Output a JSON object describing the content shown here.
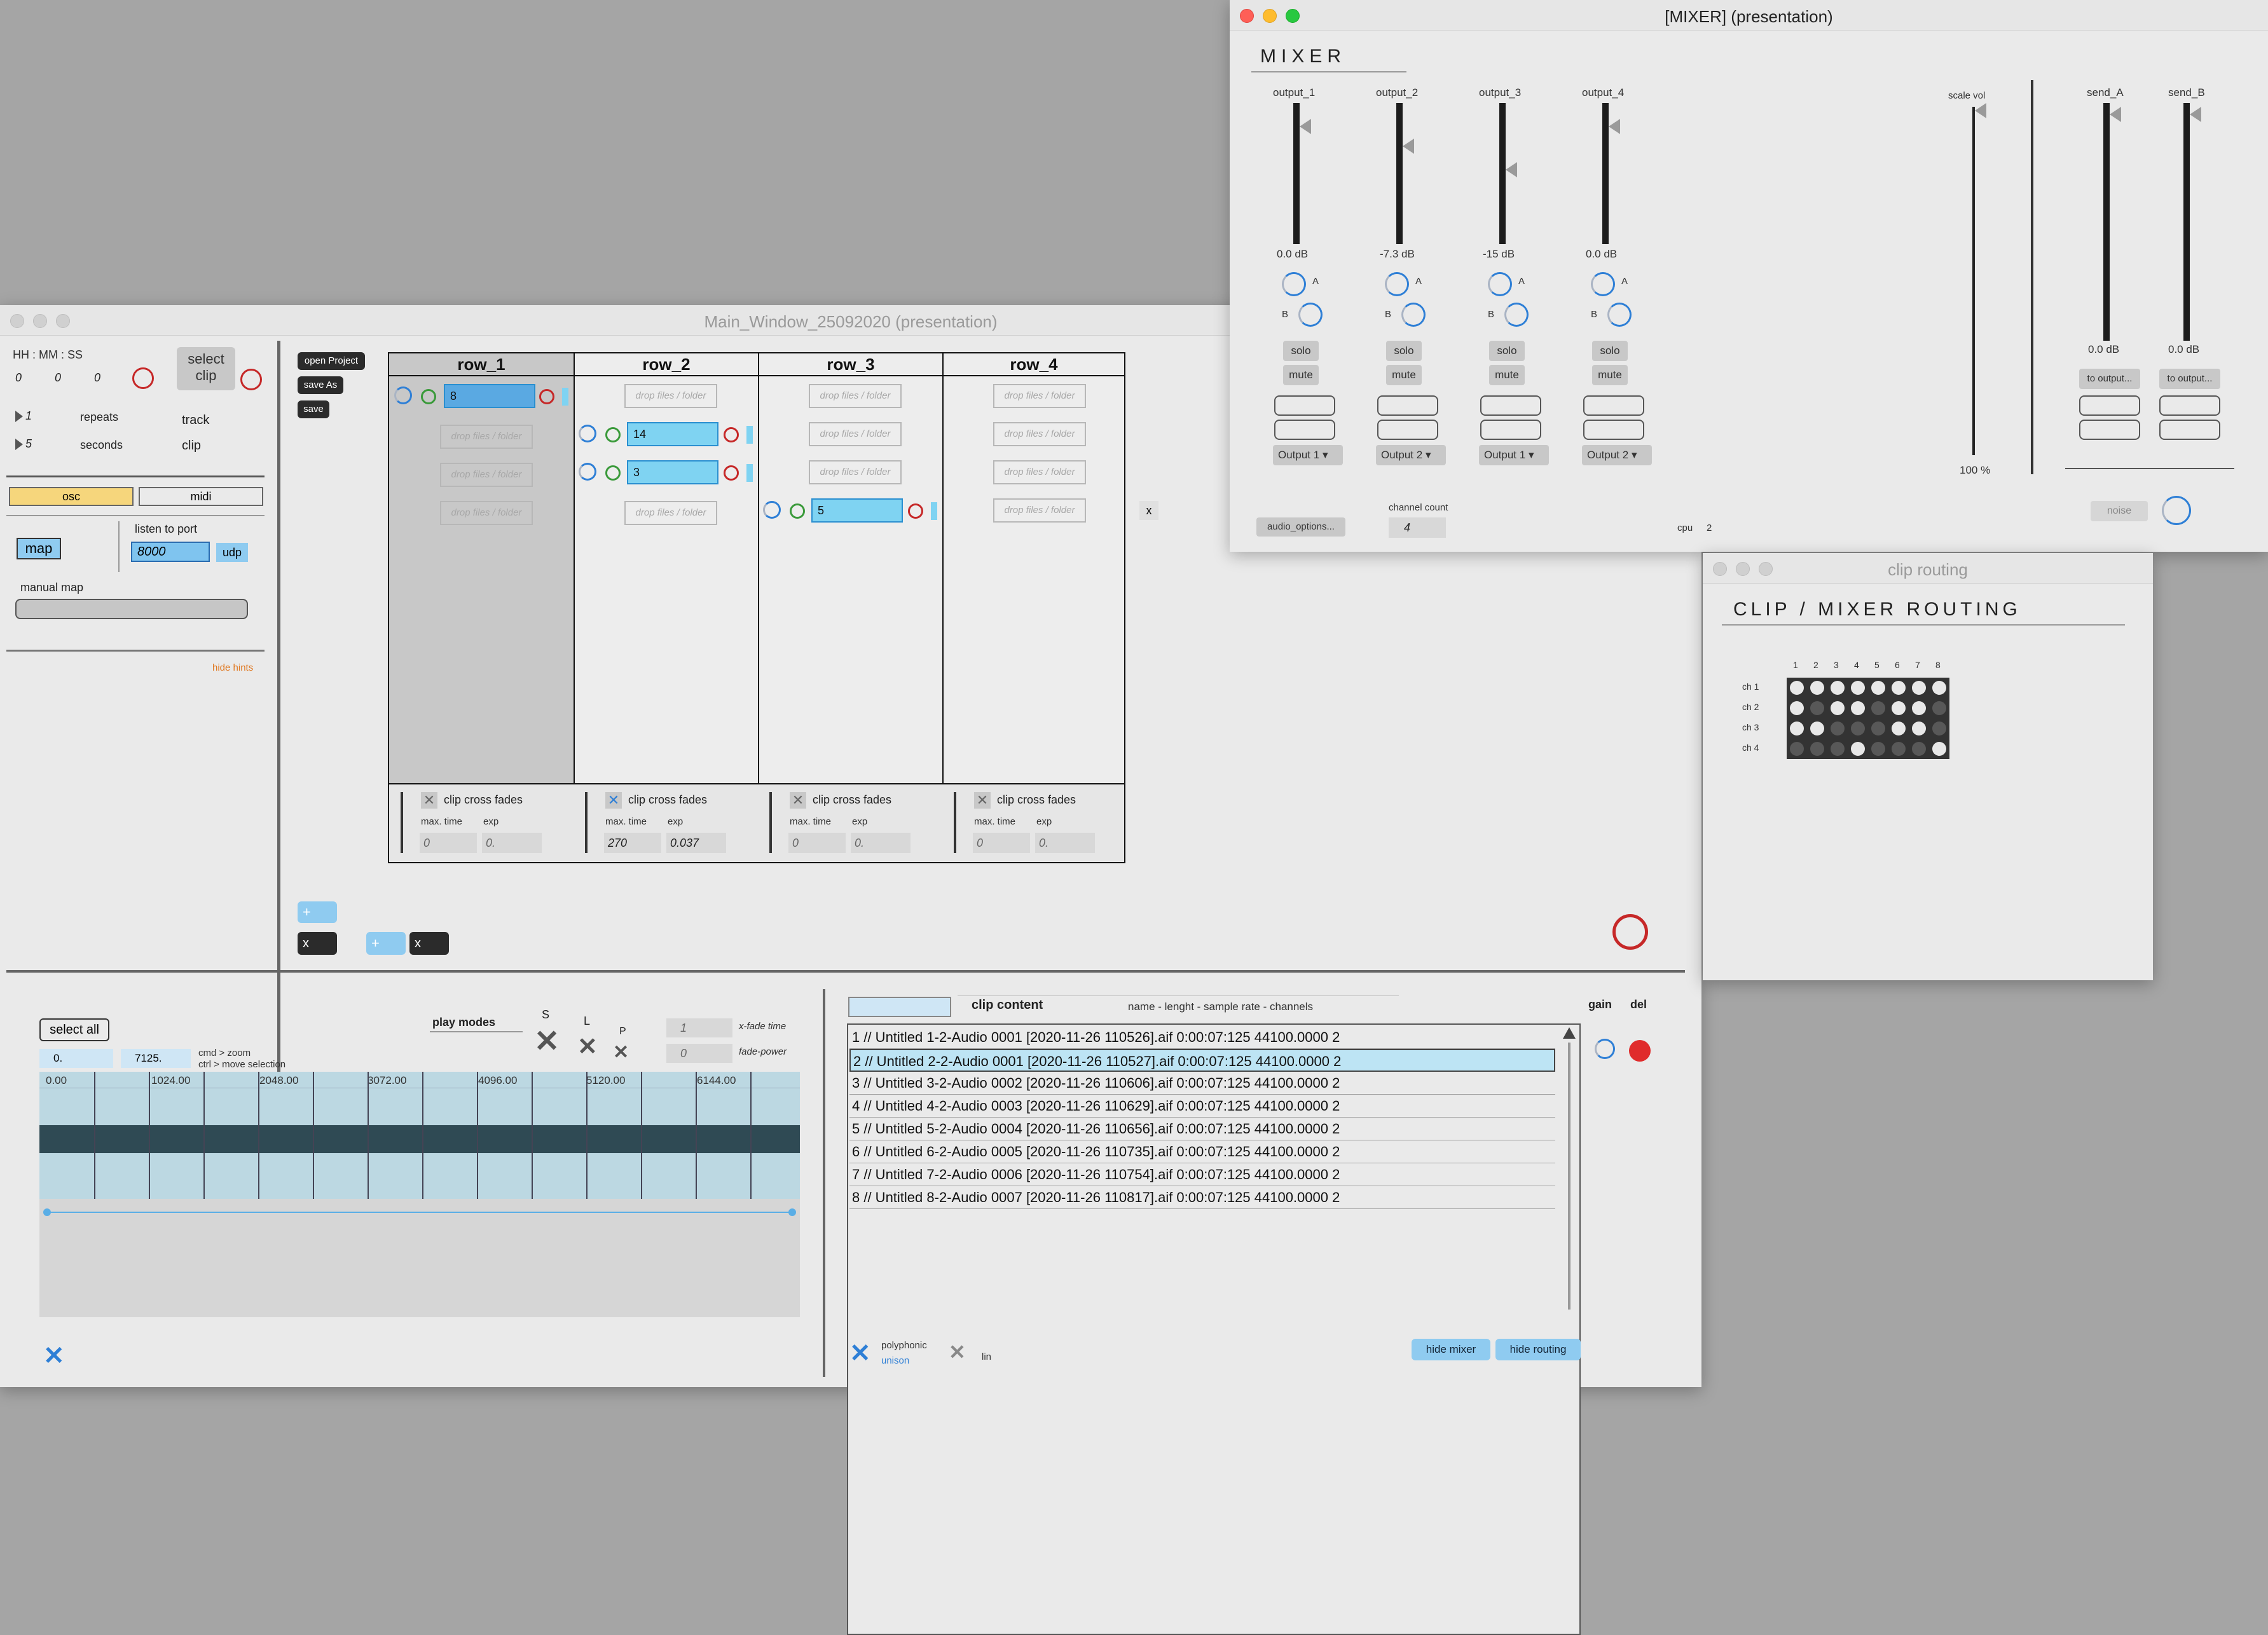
{
  "main_window": {
    "title": "Main_Window_25092020 (presentation)",
    "time_header": "HH :  MM : SS",
    "time_values": [
      "0",
      "0",
      "0"
    ],
    "select_clip_line1": "select",
    "select_clip_line2": "clip",
    "repeats_value": "1",
    "repeats_label": "repeats",
    "seconds_value": "5",
    "seconds_label": "seconds",
    "track_label": "track",
    "clip_label": "clip",
    "osc_tab": "osc",
    "midi_tab": "midi",
    "map_button": "map",
    "listen_label": "listen to port",
    "port_value": "8000",
    "udp_label": "udp",
    "manual_map_label": "manual map",
    "hide_hints": "hide hints",
    "open_project": "open Project",
    "save_as": "save As",
    "save": "save",
    "close_x": "x",
    "add_plus": "+",
    "remove_x": "x",
    "rows": [
      {
        "header": "row_1",
        "max_time": "0",
        "exp": "0.",
        "crossfade_checked": false
      },
      {
        "header": "row_2",
        "max_time": "270",
        "exp": "0.037",
        "crossfade_checked": true
      },
      {
        "header": "row_3",
        "max_time": "0",
        "exp": "0.",
        "crossfade_checked": false
      },
      {
        "header": "row_4",
        "max_time": "0",
        "exp": "0.",
        "crossfade_checked": false
      }
    ],
    "drop_label": "drop files / folder",
    "crossfade_label": "clip cross fades",
    "max_time_label": "max. time",
    "exp_label": "exp",
    "clip_values": {
      "r1c1": "8",
      "r2c2": "14",
      "r2c3": "3",
      "r3c4": "5"
    }
  },
  "bottom": {
    "select_all": "select all",
    "play_modes": "play modes",
    "mode_letters": [
      "S",
      "L",
      "P"
    ],
    "range_start": "0.",
    "range_end": "7125.",
    "hint_zoom": "cmd > zoom",
    "hint_move": "ctrl   > move selection",
    "xfade_value": "1",
    "xfade_label": "x-fade time",
    "fadepower_value": "0",
    "fadepower_label": "fade-power",
    "ruler": [
      "0.00",
      "1024.00",
      "2048.00",
      "3072.00",
      "4096.00",
      "5120.00",
      "6144.00"
    ],
    "clip_content_label": "clip content",
    "columns_label": "name - lenght - sample rate - channels",
    "gain_label": "gain",
    "del_label": "del",
    "clip_list": [
      "1 // Untitled 1-2-Audio 0001 [2020-11-26 110526].aif 0:00:07:125 44100.0000 2",
      "2 // Untitled 2-2-Audio 0001 [2020-11-26 110527].aif 0:00:07:125 44100.0000 2",
      "3 // Untitled 3-2-Audio 0002 [2020-11-26 110606].aif 0:00:07:125 44100.0000 2",
      "4 // Untitled 4-2-Audio 0003 [2020-11-26 110629].aif 0:00:07:125 44100.0000 2",
      "5 // Untitled 5-2-Audio 0004 [2020-11-26 110656].aif 0:00:07:125 44100.0000 2",
      "6 // Untitled 6-2-Audio 0005 [2020-11-26 110735].aif 0:00:07:125 44100.0000 2",
      "7 // Untitled 7-2-Audio 0006 [2020-11-26 110754].aif 0:00:07:125 44100.0000 2",
      "8 // Untitled 8-2-Audio 0007 [2020-11-26 110817].aif 0:00:07:125 44100.0000 2"
    ],
    "selected_index": 1,
    "polyphonic": "polyphonic",
    "unison": "unison",
    "lin": "lin",
    "hide_mixer": "hide mixer",
    "hide_routing": "hide routing"
  },
  "mixer": {
    "window_title": "[MIXER] (presentation)",
    "heading": "MIXER",
    "channels": [
      {
        "name": "output_1",
        "db": "0.0 dB",
        "level": 0.92,
        "route": "Output 1"
      },
      {
        "name": "output_2",
        "db": "-7.3 dB",
        "level": 0.82,
        "route": "Output 2"
      },
      {
        "name": "output_3",
        "db": "-15 dB",
        "level": 0.7,
        "route": "Output 1"
      },
      {
        "name": "output_4",
        "db": "0.0 dB",
        "level": 0.92,
        "route": "Output 2"
      }
    ],
    "knob_a": "A",
    "knob_b": "B",
    "solo": "solo",
    "mute": "mute",
    "scale_vol_label": "scale vol",
    "scale_vol_value": "100 %",
    "sends": [
      {
        "name": "send_A",
        "db": "0.0 dB",
        "button": "to output..."
      },
      {
        "name": "send_B",
        "db": "0.0 dB",
        "button": "to output..."
      }
    ],
    "audio_options": "audio_options...",
    "channel_count_label": "channel count",
    "channel_count_value": "4",
    "cpu_label": "cpu",
    "cpu_value": "2",
    "noise": "noise"
  },
  "routing": {
    "window_title": "clip routing",
    "heading": "CLIP / MIXER  ROUTING",
    "columns": [
      "1",
      "2",
      "3",
      "4",
      "5",
      "6",
      "7",
      "8"
    ],
    "rows": [
      "ch 1",
      "ch 2",
      "ch 3",
      "ch 4"
    ],
    "matrix": [
      [
        1,
        1,
        1,
        1,
        1,
        1,
        1,
        1
      ],
      [
        1,
        0,
        1,
        1,
        0,
        1,
        1,
        0
      ],
      [
        1,
        1,
        0,
        0,
        0,
        1,
        1,
        0
      ],
      [
        0,
        0,
        0,
        1,
        0,
        0,
        0,
        1
      ]
    ]
  }
}
